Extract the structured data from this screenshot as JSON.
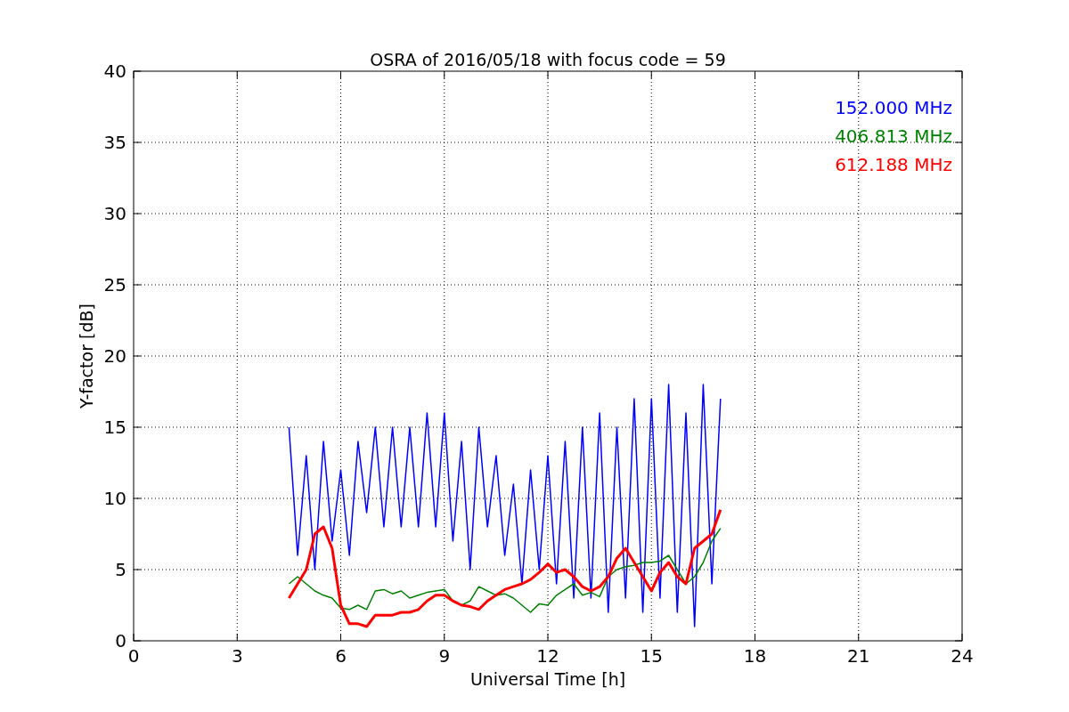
{
  "figure": {
    "chart_data": {
      "type": "line",
      "title": "OSRA of 2016/05/18 with focus code = 59",
      "xlabel": "Universal Time [h]",
      "ylabel": "Y-factor [dB]",
      "x": [
        4.5,
        4.75,
        5,
        5.25,
        5.5,
        5.75,
        6,
        6.25,
        6.5,
        6.75,
        7,
        7.25,
        7.5,
        7.75,
        8,
        8.25,
        8.5,
        8.75,
        9,
        9.25,
        9.5,
        9.75,
        10,
        10.25,
        10.5,
        10.75,
        11,
        11.25,
        11.5,
        11.75,
        12,
        12.25,
        12.5,
        12.75,
        13,
        13.25,
        13.5,
        13.75,
        14,
        14.25,
        14.5,
        14.75,
        15,
        15.25,
        15.5,
        15.75,
        16,
        16.25,
        16.5,
        16.75,
        17
      ],
      "series": [
        {
          "name": "152.000 MHz",
          "color": "#0000ff",
          "values": [
            15,
            6,
            13,
            5,
            14,
            7,
            12,
            6,
            14,
            9,
            15,
            8,
            15,
            8,
            15,
            8,
            16,
            8,
            16,
            7,
            14,
            5,
            15,
            8,
            13,
            6,
            11,
            4,
            12,
            5,
            13,
            4,
            14,
            3,
            15,
            3,
            16,
            2,
            15,
            3,
            17,
            2,
            17,
            3,
            18,
            2,
            16,
            1,
            18,
            4,
            17
          ]
        },
        {
          "name": "406.813 MHz",
          "color": "#008000",
          "values": [
            4,
            4.5,
            4,
            3.5,
            3.2,
            3,
            2.3,
            2.2,
            2.5,
            2.2,
            3.5,
            3.6,
            3.3,
            3.5,
            3,
            3.2,
            3.4,
            3.5,
            3.6,
            2.8,
            2.5,
            2.8,
            3.8,
            3.5,
            3.2,
            3.3,
            3,
            2.5,
            2,
            2.6,
            2.5,
            3.2,
            3.6,
            4,
            3.2,
            3.4,
            3.1,
            4.5,
            5,
            5.2,
            5.3,
            5.5,
            5.5,
            5.6,
            6,
            5,
            4,
            4.5,
            5.5,
            7,
            7.9
          ]
        },
        {
          "name": "612.188 MHz",
          "color": "#ff0000",
          "values": [
            3,
            4,
            5,
            7.5,
            8,
            6.5,
            2.5,
            1.2,
            1.2,
            1,
            1.8,
            1.8,
            1.8,
            2,
            2,
            2.2,
            2.8,
            3.2,
            3.2,
            2.8,
            2.5,
            2.4,
            2.2,
            2.8,
            3.2,
            3.6,
            3.8,
            4,
            4.3,
            4.8,
            5.4,
            4.8,
            5,
            4.5,
            3.8,
            3.5,
            3.8,
            4.5,
            5.8,
            6.5,
            5.5,
            4.5,
            3.5,
            4.8,
            5.5,
            4.5,
            4,
            6.5,
            7,
            7.5,
            9.2
          ]
        }
      ],
      "grid": true,
      "xlim": [
        0,
        24
      ],
      "ylim": [
        0,
        40
      ],
      "xticks": [
        0,
        3,
        6,
        9,
        12,
        15,
        18,
        21,
        24
      ],
      "yticks": [
        0,
        5,
        10,
        15,
        20,
        25,
        30,
        35,
        40
      ]
    }
  }
}
